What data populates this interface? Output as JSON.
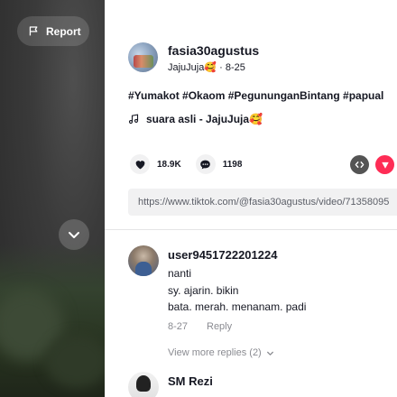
{
  "video": {
    "report_label": "Report"
  },
  "post": {
    "author": "fasia30agustus",
    "nickname": "JajuJuja🥰",
    "date": "8-25",
    "hashtags": "#Yumakot #Okaom #PegununganBintang #papual",
    "music": "suara asli - JajuJuja🥰",
    "likes": "18.9K",
    "comments": "1198",
    "link": "https://www.tiktok.com/@fasia30agustus/video/71358095"
  },
  "comments": [
    {
      "username": "user9451722201224",
      "lines": [
        "nanti",
        "sy. ajarin. bikin",
        "bata. merah. menanam. padi"
      ],
      "date": "8-27",
      "reply_label": "Reply",
      "view_more": "View more replies (2)"
    },
    {
      "username": "SM Rezi"
    }
  ],
  "colors": {
    "accent": "#fe2c55",
    "text": "#161823",
    "muted": "#8a8b91"
  }
}
